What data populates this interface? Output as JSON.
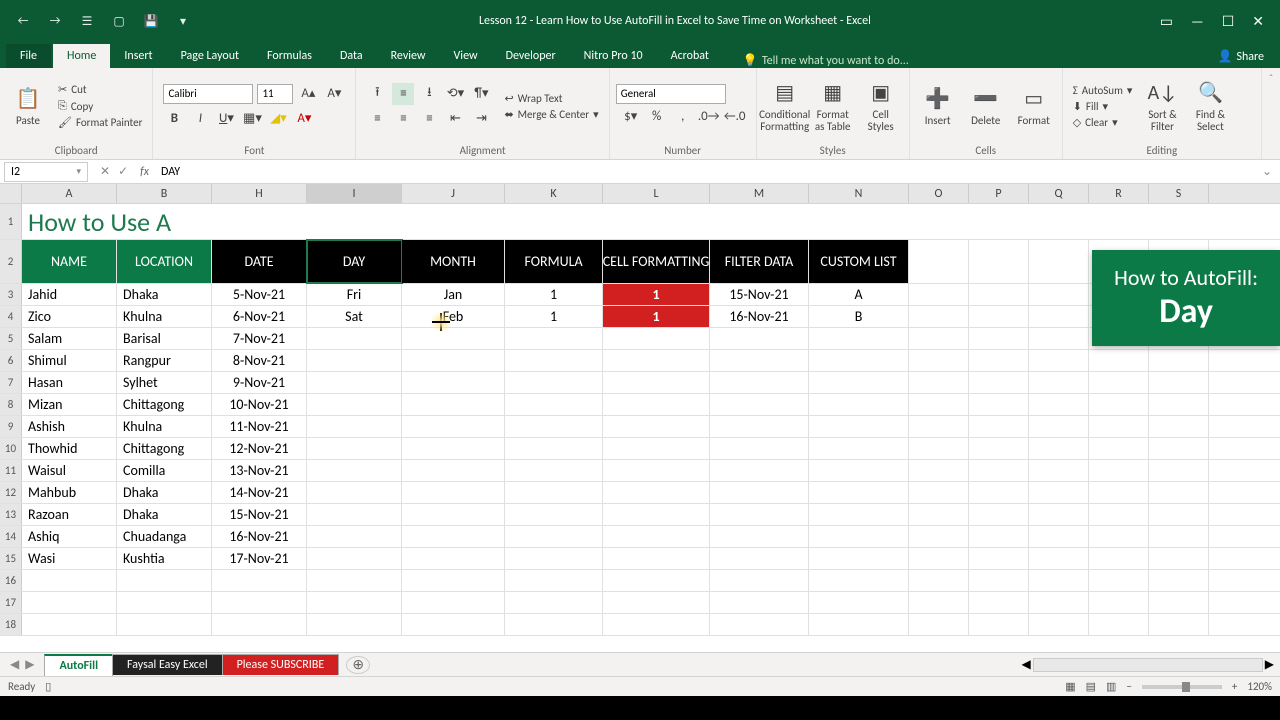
{
  "window": {
    "title": "Lesson 12 - Learn How to Use AutoFill in Excel to Save Time on Worksheet - Excel"
  },
  "ribbon": {
    "tabs": [
      "File",
      "Home",
      "Insert",
      "Page Layout",
      "Formulas",
      "Data",
      "Review",
      "View",
      "Developer",
      "Nitro Pro 10",
      "Acrobat"
    ],
    "tellme": "Tell me what you want to do...",
    "share": "Share",
    "clipboard": {
      "label": "Clipboard",
      "paste": "Paste",
      "cut": "Cut",
      "copy": "Copy",
      "painter": "Format Painter"
    },
    "font": {
      "label": "Font",
      "name": "Calibri",
      "size": "11"
    },
    "alignment": {
      "label": "Alignment",
      "wrap": "Wrap Text",
      "merge": "Merge & Center"
    },
    "number": {
      "label": "Number",
      "format": "General"
    },
    "styles": {
      "label": "Styles",
      "cond": "Conditional Formatting",
      "table": "Format as Table",
      "cell": "Cell Styles"
    },
    "cells": {
      "label": "Cells",
      "insert": "Insert",
      "delete": "Delete",
      "format": "Format"
    },
    "editing": {
      "label": "Editing",
      "autosum": "AutoSum",
      "fill": "Fill",
      "clear": "Clear",
      "sort": "Sort & Filter",
      "find": "Find & Select"
    }
  },
  "fxbar": {
    "ref": "I2",
    "fx": "fx",
    "formula": "DAY"
  },
  "columns": [
    "A",
    "B",
    "H",
    "I",
    "J",
    "K",
    "L",
    "M",
    "N",
    "O",
    "P",
    "Q",
    "R",
    "S"
  ],
  "title_cell": "How to Use A",
  "headers": {
    "A": "NAME",
    "B": "LOCATION",
    "H": "DATE",
    "I": "DAY",
    "J": "MONTH",
    "K": "FORMULA",
    "L": "CELL FORMATTING",
    "M": "FILTER DATA",
    "N": "CUSTOM LIST"
  },
  "rows": [
    {
      "n": 3,
      "A": "Jahid",
      "B": "Dhaka",
      "H": "5-Nov-21",
      "I": "Fri",
      "J": "Jan",
      "K": "1",
      "L": "1",
      "M": "15-Nov-21",
      "N": "A"
    },
    {
      "n": 4,
      "A": "Zico",
      "B": "Khulna",
      "H": "6-Nov-21",
      "I": "Sat",
      "J": "Feb",
      "K": "1",
      "L": "1",
      "M": "16-Nov-21",
      "N": "B"
    },
    {
      "n": 5,
      "A": "Salam",
      "B": "Barisal",
      "H": "7-Nov-21"
    },
    {
      "n": 6,
      "A": "Shimul",
      "B": "Rangpur",
      "H": "8-Nov-21"
    },
    {
      "n": 7,
      "A": "Hasan",
      "B": "Sylhet",
      "H": "9-Nov-21"
    },
    {
      "n": 8,
      "A": "Mizan",
      "B": "Chittagong",
      "H": "10-Nov-21"
    },
    {
      "n": 9,
      "A": "Ashish",
      "B": "Khulna",
      "H": "11-Nov-21"
    },
    {
      "n": 10,
      "A": "Thowhid",
      "B": "Chittagong",
      "H": "12-Nov-21"
    },
    {
      "n": 11,
      "A": "Waisul",
      "B": "Comilla",
      "H": "13-Nov-21"
    },
    {
      "n": 12,
      "A": "Mahbub",
      "B": "Dhaka",
      "H": "14-Nov-21"
    },
    {
      "n": 13,
      "A": "Razoan",
      "B": "Dhaka",
      "H": "15-Nov-21"
    },
    {
      "n": 14,
      "A": "Ashiq",
      "B": "Chuadanga",
      "H": "16-Nov-21"
    },
    {
      "n": 15,
      "A": "Wasi",
      "B": "Kushtia",
      "H": "17-Nov-21"
    },
    {
      "n": 16
    },
    {
      "n": 17
    },
    {
      "n": 18
    }
  ],
  "overlay": {
    "line1": "How to AutoFill:",
    "line2": "Day"
  },
  "sheets": {
    "s1": "AutoFill",
    "s2": "Faysal Easy Excel",
    "s3": "Please SUBSCRIBE"
  },
  "status": {
    "ready": "Ready",
    "zoom": "120%"
  }
}
